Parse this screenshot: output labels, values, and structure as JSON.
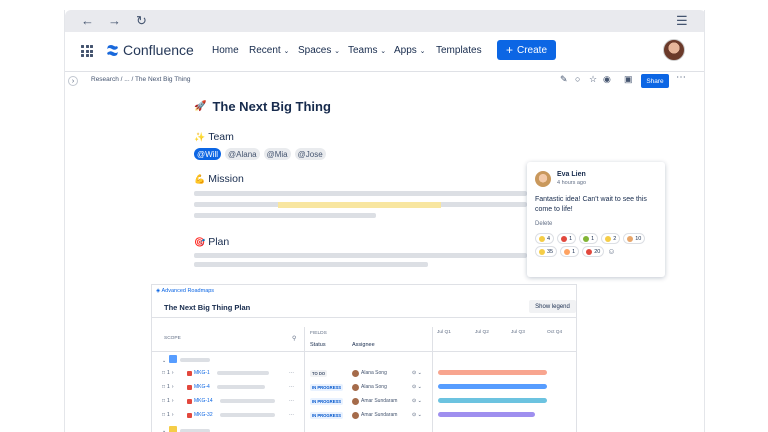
{
  "browser": {
    "back_icon": "arrow-left-icon",
    "forward_icon": "arrow-right-icon",
    "reload_icon": "reload-icon",
    "menu_icon": "hamburger-icon"
  },
  "nav": {
    "logo": "Confluence",
    "items": [
      "Home",
      "Recent",
      "Spaces",
      "Teams",
      "Apps",
      "Templates"
    ],
    "create": "Create"
  },
  "breadcrumb": "Research  /  ...  /  The Next Big Thing",
  "toolbar": {
    "share": "Share"
  },
  "page": {
    "title": "The Next Big Thing",
    "team_heading": "Team",
    "mentions": [
      "@Will",
      "@Alana",
      "@Mia",
      "@Jose"
    ],
    "mission_heading": "Mission",
    "plan_heading": "Plan"
  },
  "comment": {
    "author": "Eva Lien",
    "time": "4 hours ago",
    "text": "Fantastic idea! Can't wait to see this come to life!",
    "delete": "Delete",
    "reactions": [
      {
        "count": "4",
        "color": "#f5cd47"
      },
      {
        "count": "1",
        "color": "#e2483d"
      },
      {
        "count": "1",
        "color": "#82b536"
      },
      {
        "count": "2",
        "color": "#f5cd47"
      },
      {
        "count": "10",
        "color": "#e8a66a"
      },
      {
        "count": "35",
        "color": "#f5cd47"
      },
      {
        "count": "1",
        "color": "#fea362"
      },
      {
        "count": "20",
        "color": "#e2483d"
      }
    ]
  },
  "roadmap": {
    "label": "Advanced Roadmaps",
    "title": "The Next Big Thing Plan",
    "show_legend": "Show legend",
    "scope": "SCOPE",
    "fields": "FIELDS",
    "status_col": "Status",
    "assignee_col": "Assignee",
    "quarters": [
      "Jul Q1",
      "Jul Q2",
      "Jul Q3",
      "Oct Q4"
    ],
    "rows": [
      {
        "num": "1",
        "key": "MKG-1",
        "status": "TO DO",
        "assignee": "Alana Song",
        "progress": 0.72,
        "color": "#f8a58f"
      },
      {
        "num": "1",
        "key": "MKG-4",
        "status": "IN PROGRESS",
        "assignee": "Alana Song",
        "progress": 0.72,
        "color": "#579dff"
      },
      {
        "num": "1",
        "key": "MKG-14",
        "status": "IN PROGRESS",
        "assignee": "Amar Sundaram",
        "progress": 0.72,
        "color": "#6cc3e0"
      },
      {
        "num": "1",
        "key": "MKG-32",
        "status": "IN PROGRESS",
        "assignee": "Amar Sundaram",
        "progress": 0.64,
        "color": "#9f8fef"
      }
    ]
  }
}
